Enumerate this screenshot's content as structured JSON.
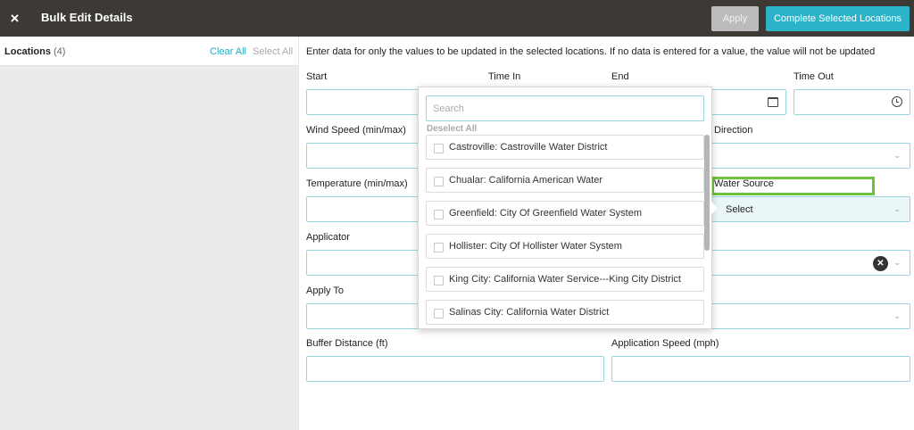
{
  "header": {
    "close_icon": "×",
    "title": "Bulk Edit Details",
    "apply_label": "Apply",
    "complete_label": "Complete Selected Locations"
  },
  "sidebar": {
    "locations_label": "Locations",
    "locations_count": "(4)",
    "clear_all": "Clear All",
    "select_all": "Select All"
  },
  "main": {
    "instructions": "Enter data for only the values to be updated in the selected locations. If no data is entered for a value, the value will not be updated",
    "labels": {
      "start": "Start",
      "time_in": "Time In",
      "end": "End",
      "time_out": "Time Out",
      "wind_speed": "Wind Speed (min/max)",
      "direction": "Direction",
      "temperature": "Temperature (min/max)",
      "water_source": "Water Source",
      "applicator": "Applicator",
      "apply_to": "Apply To",
      "buffer_distance": "Buffer Distance (ft)",
      "application_speed": "Application Speed (mph)"
    },
    "water_source_value": "Select"
  },
  "dropdown": {
    "search_placeholder": "Search",
    "deselect_all": "Deselect All",
    "items": [
      "Castroville: Castroville Water District",
      "Chualar: California American Water",
      "Greenfield: City Of Greenfield Water System",
      "Hollister: City Of Hollister Water System",
      "King City: California Water Service---King City District",
      "Salinas City: California Water District"
    ]
  },
  "icons": {
    "chevron": "⌄",
    "clear": "✕"
  },
  "colors": {
    "header_bg": "#3d3a36",
    "accent": "#2cb3c8",
    "highlight": "#6fc23d"
  }
}
